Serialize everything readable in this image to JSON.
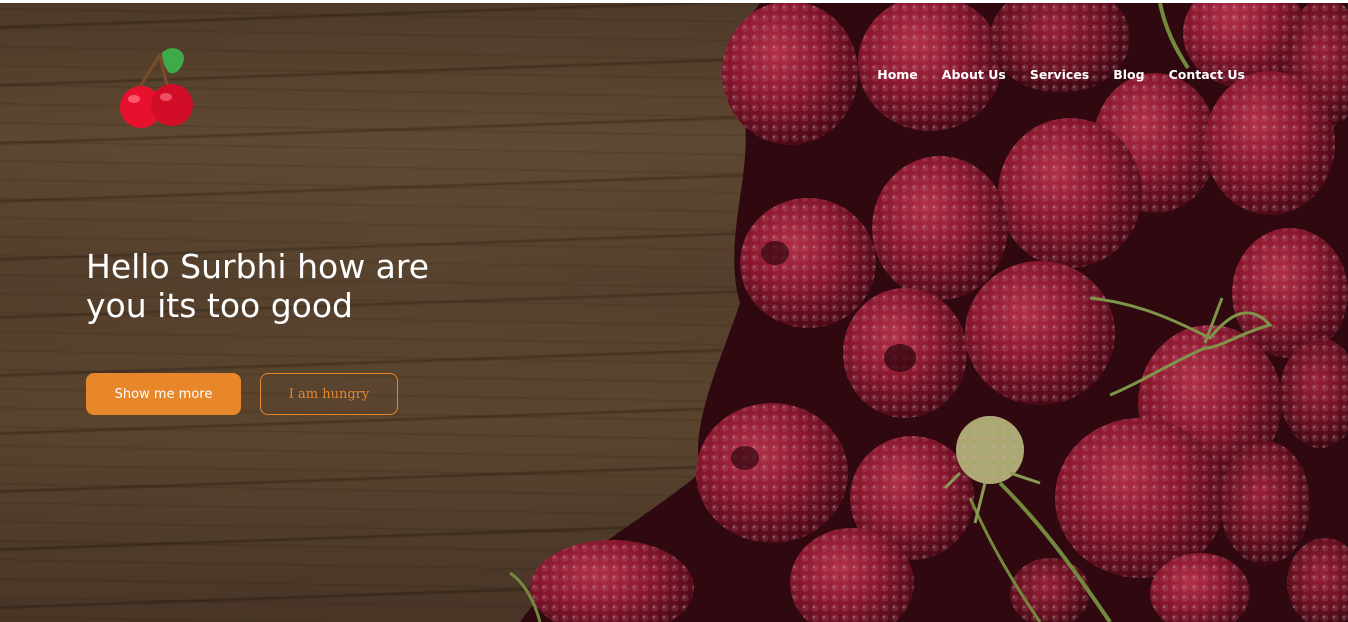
{
  "brand": {
    "logo_icon": "cherry-icon",
    "colors": {
      "cherry_red": "#e8112d",
      "leaf_green": "#3faa4a",
      "stem_brown": "#7a4a2a"
    }
  },
  "nav": {
    "items": [
      {
        "label": "Home"
      },
      {
        "label": "About Us"
      },
      {
        "label": "Services"
      },
      {
        "label": "Blog"
      },
      {
        "label": "Contact Us"
      }
    ]
  },
  "hero": {
    "headline_line1": "Hello Surbhi how are",
    "headline_line2": "you its too good",
    "primary_button_label": "Show me more",
    "secondary_button_label": "I am hungry",
    "accent_color": "#e8862a",
    "background_image": "raspberries-on-wood"
  }
}
